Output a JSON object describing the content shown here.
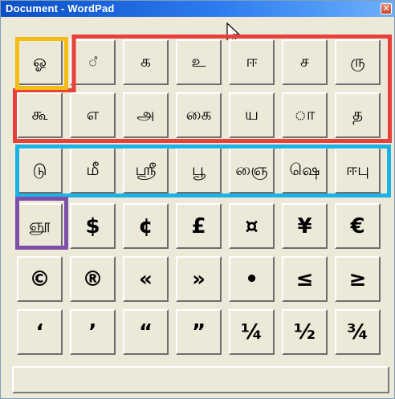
{
  "window": {
    "title": "Document - WordPad",
    "close_label": "✕"
  },
  "rows": [
    [
      "ஓ",
      "ஂ",
      "க",
      "உ",
      "ஈ",
      "ச",
      "ரு"
    ],
    [
      "கூ",
      "எ",
      "அ",
      "கை",
      "ய",
      "ா",
      "த"
    ],
    [
      "டு",
      "மீ",
      "ஸ்ரீ",
      "பூ",
      "ஞை",
      "ஷெ",
      "ஈபு"
    ],
    [
      "ஞூ",
      "$",
      "¢",
      "£",
      "¤",
      "¥",
      "€"
    ],
    [
      "©",
      "®",
      "«",
      "»",
      "•",
      "≤",
      "≥"
    ],
    [
      "‘",
      "’",
      "“",
      "”",
      "¼",
      "½",
      "¾"
    ]
  ],
  "highlight_colors": {
    "yellow": "#f3bd13",
    "red": "#e8403a",
    "cyan": "#1bb3e5",
    "purple": "#7c4fa9"
  },
  "icons": {
    "cursor": "mouse-pointer-icon",
    "close": "close-icon"
  }
}
